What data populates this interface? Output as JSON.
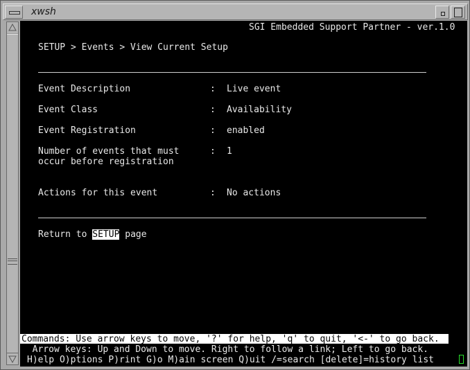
{
  "window": {
    "title": "xwsh"
  },
  "terminal": {
    "header": "SGI Embedded Support Partner - ver.1.0",
    "breadcrumb": "SETUP > Events > View Current Setup",
    "fields": [
      {
        "label": "Event Description",
        "sep": ":",
        "value": "Live event"
      },
      {
        "label": "Event Class",
        "sep": ":",
        "value": "Availability"
      },
      {
        "label": "Event Registration",
        "sep": ":",
        "value": "enabled"
      },
      {
        "label": "Number of events that must",
        "label2": "occur before registration",
        "sep": ":",
        "value": "1"
      },
      {
        "label": "Actions for this event",
        "sep": ":",
        "value": "No actions"
      }
    ],
    "return_prefix": "Return to ",
    "return_link": "SETUP",
    "return_suffix": " page",
    "commands_line": "Commands: Use arrow keys to move, '?' for help, 'q' to quit, '<-' to go back.",
    "arrow_keys_line": "  Arrow keys: Up and Down to move. Right to follow a link; Left to go back.",
    "shortcuts_line": "H)elp O)ptions P)rint G)o M)ain screen Q)uit /=search [delete]=history list"
  },
  "colors": {
    "terminal_bg": "#000000",
    "terminal_fg": "#e8e8e8",
    "cursor": "#29e02b",
    "chrome": "#b5b5b5"
  }
}
